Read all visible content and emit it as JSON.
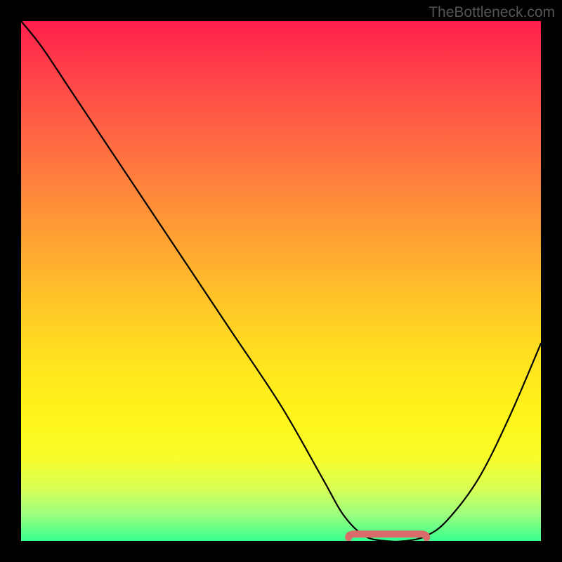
{
  "watermark": "TheBottleneck.com",
  "chart_data": {
    "type": "line",
    "title": "",
    "xlabel": "",
    "ylabel": "",
    "xlim": [
      0,
      100
    ],
    "ylim": [
      0,
      100
    ],
    "series": [
      {
        "name": "bottleneck-curve",
        "x": [
          0,
          4,
          10,
          20,
          30,
          40,
          50,
          58,
          62,
          66,
          70,
          74,
          78,
          82,
          88,
          94,
          100
        ],
        "y": [
          100,
          95,
          86,
          71,
          56,
          41,
          26,
          12,
          5,
          1,
          0,
          0,
          1,
          4,
          12,
          24,
          38
        ]
      }
    ],
    "annotations": [
      {
        "name": "optimal-band",
        "type": "segment",
        "x": [
          63,
          78
        ],
        "y": [
          0.5,
          0.5
        ],
        "color": "#d96b6b"
      }
    ]
  }
}
